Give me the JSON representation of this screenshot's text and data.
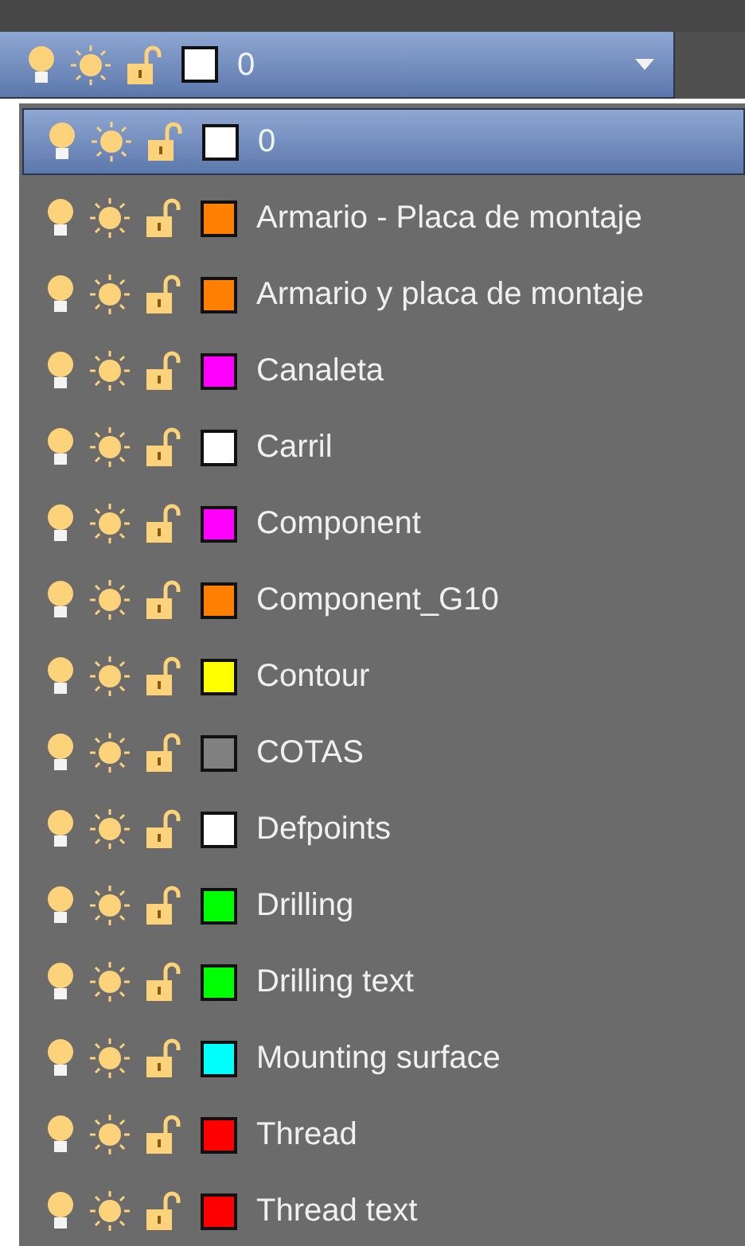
{
  "current_layer": {
    "name": "0",
    "color": "#ffffff",
    "on": true,
    "frozen": false,
    "locked": false
  },
  "layers": [
    {
      "name": "0",
      "color": "#ffffff",
      "on": true,
      "frozen": false,
      "locked": false,
      "selected": true
    },
    {
      "name": "Armario - Placa de montaje",
      "color": "#ff7f00",
      "on": true,
      "frozen": false,
      "locked": false,
      "selected": false
    },
    {
      "name": "Armario y placa de montaje",
      "color": "#ff7f00",
      "on": true,
      "frozen": false,
      "locked": false,
      "selected": false
    },
    {
      "name": "Canaleta",
      "color": "#ff00ff",
      "on": true,
      "frozen": false,
      "locked": false,
      "selected": false
    },
    {
      "name": "Carril",
      "color": "#ffffff",
      "on": true,
      "frozen": false,
      "locked": false,
      "selected": false
    },
    {
      "name": "Component",
      "color": "#ff00ff",
      "on": true,
      "frozen": false,
      "locked": false,
      "selected": false
    },
    {
      "name": "Component_G10",
      "color": "#ff7f00",
      "on": true,
      "frozen": false,
      "locked": false,
      "selected": false
    },
    {
      "name": "Contour",
      "color": "#ffff00",
      "on": true,
      "frozen": false,
      "locked": false,
      "selected": false
    },
    {
      "name": "COTAS",
      "color": "#808080",
      "on": true,
      "frozen": false,
      "locked": false,
      "selected": false
    },
    {
      "name": "Defpoints",
      "color": "#ffffff",
      "on": true,
      "frozen": false,
      "locked": false,
      "selected": false
    },
    {
      "name": "Drilling",
      "color": "#00ff00",
      "on": true,
      "frozen": false,
      "locked": false,
      "selected": false
    },
    {
      "name": "Drilling text",
      "color": "#00ff00",
      "on": true,
      "frozen": false,
      "locked": false,
      "selected": false
    },
    {
      "name": "Mounting surface",
      "color": "#00ffff",
      "on": true,
      "frozen": false,
      "locked": false,
      "selected": false
    },
    {
      "name": "Thread",
      "color": "#ff0000",
      "on": true,
      "frozen": false,
      "locked": false,
      "selected": false
    },
    {
      "name": "Thread text",
      "color": "#ff0000",
      "on": true,
      "frozen": false,
      "locked": false,
      "selected": false
    }
  ]
}
